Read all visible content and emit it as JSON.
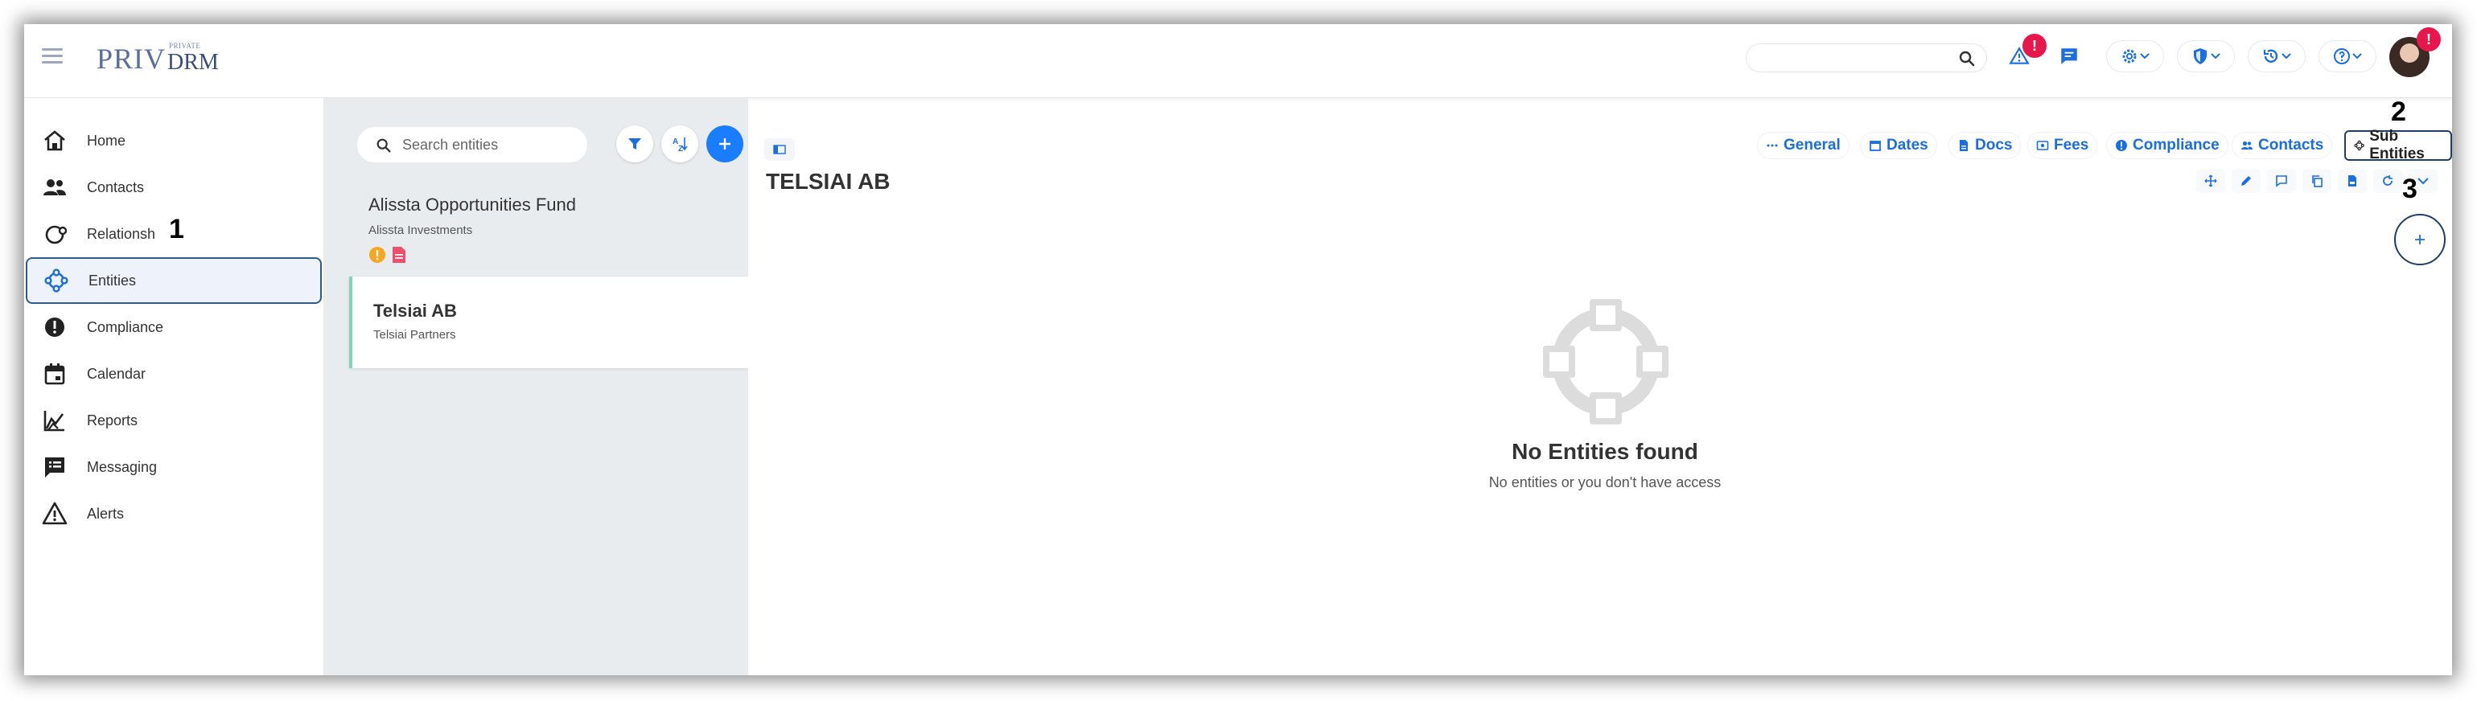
{
  "app": {
    "logo_main": "PRIV",
    "logo_sup": "PRIVATE",
    "logo_sub": "DRM"
  },
  "header": {
    "search_placeholder": "",
    "alert_badge": "!",
    "avatar_badge": "!"
  },
  "sidebar": {
    "items": [
      {
        "label": "Home",
        "icon": "home-icon"
      },
      {
        "label": "Contacts",
        "icon": "contacts-icon"
      },
      {
        "label": "Relationsh",
        "icon": "relationships-icon"
      },
      {
        "label": "Entities",
        "icon": "entities-icon",
        "active": true
      },
      {
        "label": "Compliance",
        "icon": "compliance-icon"
      },
      {
        "label": "Calendar",
        "icon": "calendar-icon"
      },
      {
        "label": "Reports",
        "icon": "reports-icon"
      },
      {
        "label": "Messaging",
        "icon": "messaging-icon"
      },
      {
        "label": "Alerts",
        "icon": "alerts-icon"
      }
    ]
  },
  "annotations": {
    "a1": "1",
    "a2": "2",
    "a3": "3"
  },
  "entity_list": {
    "search_placeholder": "Search entities",
    "items": [
      {
        "title": "Alissta Opportunities Fund",
        "subtitle": "Alissta Investments",
        "selected": false
      },
      {
        "title": "Telsiai AB",
        "subtitle": "Telsiai Partners",
        "selected": true
      }
    ]
  },
  "main": {
    "title": "TELSIAI AB",
    "tabs": [
      {
        "label": "General",
        "icon": "dots-icon"
      },
      {
        "label": "Dates",
        "icon": "calendar-icon"
      },
      {
        "label": "Docs",
        "icon": "document-icon"
      },
      {
        "label": "Fees",
        "icon": "fees-icon"
      },
      {
        "label": "Compliance",
        "icon": "compliance-icon"
      },
      {
        "label": "Contacts",
        "icon": "contacts-icon"
      },
      {
        "label": "Sub Entities",
        "icon": "entities-icon",
        "active": true
      }
    ],
    "empty_title": "No Entities found",
    "empty_subtitle": "No entities or you don't have access"
  },
  "colors": {
    "accent": "#1a7dff",
    "badge": "#e8174b",
    "active_border": "#2e5b8d",
    "tab_text": "#1a6fe0"
  }
}
